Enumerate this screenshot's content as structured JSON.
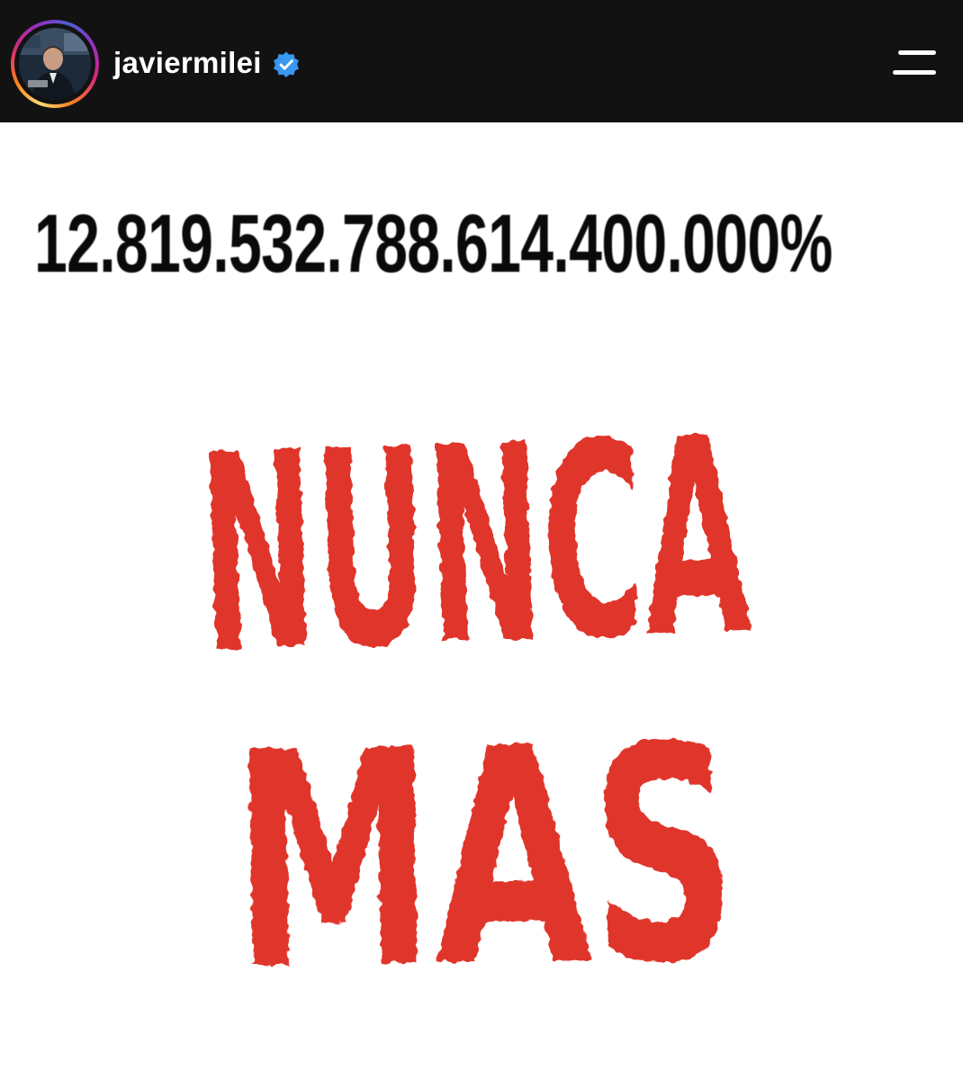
{
  "header": {
    "username": "javiermilei",
    "verified": true,
    "avatar_icon": "profile-photo",
    "menu_icon": "hamburger-menu-icon"
  },
  "post": {
    "headline_number": "12.819.532.788.614.400.000%",
    "slogan_line1": "NUNCA",
    "slogan_line2": "MAS",
    "colors": {
      "slogan": "#e0352b",
      "header_bg": "#121212",
      "verified": "#3897f0"
    }
  }
}
